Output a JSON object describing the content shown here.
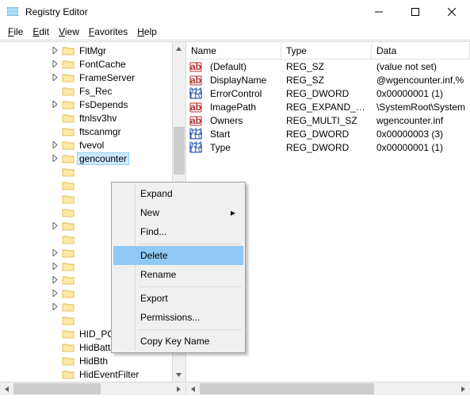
{
  "window": {
    "title": "Registry Editor"
  },
  "menu": {
    "file": "File",
    "edit": "Edit",
    "view": "View",
    "favorites": "Favorites",
    "help": "Help"
  },
  "tree": {
    "items": [
      {
        "label": "FltMgr",
        "expandable": true
      },
      {
        "label": "FontCache",
        "expandable": true
      },
      {
        "label": "FrameServer",
        "expandable": true
      },
      {
        "label": "Fs_Rec",
        "expandable": false
      },
      {
        "label": "FsDepends",
        "expandable": true
      },
      {
        "label": "ftnlsv3hv",
        "expandable": false
      },
      {
        "label": "ftscanmgr",
        "expandable": false
      },
      {
        "label": "fvevol",
        "expandable": true
      },
      {
        "label": "gencounter",
        "expandable": true,
        "selected": true
      },
      {
        "label": "",
        "expandable": false
      },
      {
        "label": "",
        "expandable": false
      },
      {
        "label": "",
        "expandable": false
      },
      {
        "label": "",
        "expandable": false
      },
      {
        "label": "",
        "expandable": true
      },
      {
        "label": "",
        "expandable": false
      },
      {
        "label": "",
        "expandable": true
      },
      {
        "label": "",
        "expandable": true
      },
      {
        "label": "",
        "expandable": true
      },
      {
        "label": "",
        "expandable": true
      },
      {
        "label": "",
        "expandable": true
      },
      {
        "label": "",
        "expandable": false
      },
      {
        "label": "HID_PCI",
        "expandable": false
      },
      {
        "label": "HidBatt",
        "expandable": false
      },
      {
        "label": "HidBth",
        "expandable": false
      },
      {
        "label": "HidEventFilter",
        "expandable": false
      }
    ]
  },
  "list": {
    "headers": {
      "name": "Name",
      "type": "Type",
      "data": "Data"
    },
    "rows": [
      {
        "icon": "sz",
        "name": "(Default)",
        "type": "REG_SZ",
        "data": "(value not set)"
      },
      {
        "icon": "sz",
        "name": "DisplayName",
        "type": "REG_SZ",
        "data": "@wgencounter.inf,%"
      },
      {
        "icon": "dw",
        "name": "ErrorControl",
        "type": "REG_DWORD",
        "data": "0x00000001 (1)"
      },
      {
        "icon": "sz",
        "name": "ImagePath",
        "type": "REG_EXPAND_SZ",
        "data": "\\SystemRoot\\System"
      },
      {
        "icon": "sz",
        "name": "Owners",
        "type": "REG_MULTI_SZ",
        "data": "wgencounter.inf"
      },
      {
        "icon": "dw",
        "name": "Start",
        "type": "REG_DWORD",
        "data": "0x00000003 (3)"
      },
      {
        "icon": "dw",
        "name": "Type",
        "type": "REG_DWORD",
        "data": "0x00000001 (1)"
      }
    ]
  },
  "context_menu": {
    "expand": "Expand",
    "new": "New",
    "find": "Find...",
    "delete": "Delete",
    "rename": "Rename",
    "export": "Export",
    "permissions": "Permissions...",
    "copy_key_name": "Copy Key Name"
  }
}
